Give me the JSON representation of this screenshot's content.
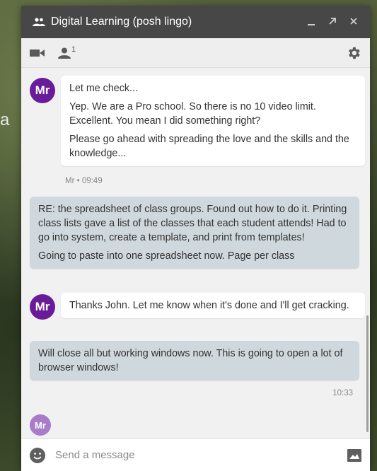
{
  "background": {
    "fragment_text": "a"
  },
  "titlebar": {
    "title": "Digital Learning (posh lingo)",
    "minimize_icon": "minimize-icon",
    "popout_icon": "popout-icon",
    "close_icon": "close-icon"
  },
  "toolbar": {
    "video_icon": "video-icon",
    "participants_count": "1",
    "settings_icon": "gear-icon"
  },
  "messages": [
    {
      "sender": "other",
      "avatar": "Mr",
      "paragraphs": [
        "Let me check...",
        "Yep. We are a Pro school.  So there is no 10 video limit. Excellent.  You mean I did something right?",
        "Please go ahead with spreading the love and the skills and the knowledge..."
      ],
      "meta": "Mr • 09:49"
    },
    {
      "sender": "self",
      "paragraphs": [
        "RE: the spreadsheet of class groups. Found out how to do it. Printing class lists gave a list of the classes that each student attends! Had to go into system, create a template, and print from templates!",
        "Going to paste into one spreadsheet now.  Page per class"
      ]
    },
    {
      "sender": "other",
      "avatar": "Mr",
      "paragraphs": [
        "Thanks John.  Let me know when it's done and I'll get cracking."
      ]
    },
    {
      "sender": "self",
      "paragraphs": [
        "Will close all but working windows now.  This is going to open a lot of browser windows!"
      ],
      "meta": "10:33"
    }
  ],
  "typing_avatar": "Mr",
  "composer": {
    "placeholder": "Send a message",
    "emoji_icon": "emoji-icon",
    "image_icon": "image-icon"
  },
  "colors": {
    "titlebar": "#474747",
    "avatar": "#6a1b9a",
    "own_bubble": "#cfd8dc"
  }
}
